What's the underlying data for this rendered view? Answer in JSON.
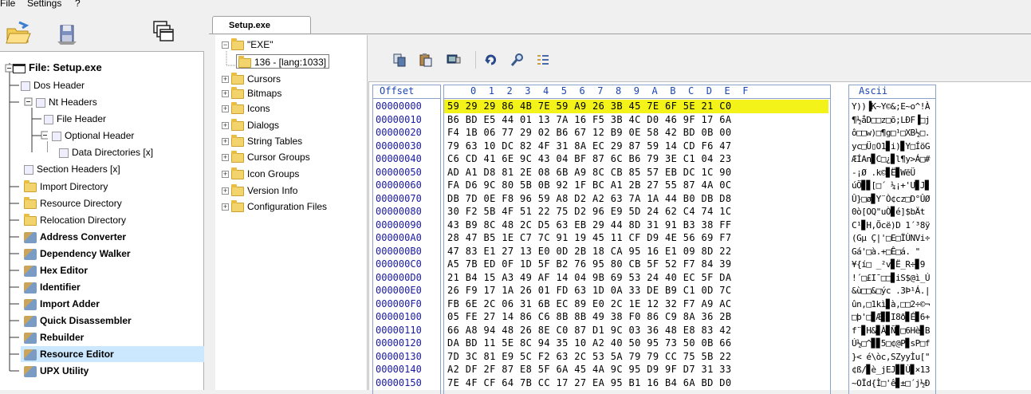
{
  "menu": {
    "file": "File",
    "settings": "Settings",
    "help": "?"
  },
  "left_tree": {
    "items": [
      {
        "label": "File: Setup.exe",
        "bold": true,
        "icon": "window-icon"
      },
      {
        "label": "Dos Header",
        "icon": "list-icon"
      },
      {
        "label": "Nt Headers",
        "icon": "list-icon"
      },
      {
        "label": "File Header",
        "icon": "list-icon"
      },
      {
        "label": "Optional Header",
        "icon": "list-icon"
      },
      {
        "label": "Data Directories [x]",
        "icon": "list-icon"
      },
      {
        "label": "Section Headers [x]",
        "icon": "list-icon"
      },
      {
        "label": "Import Directory",
        "icon": "folder-icon"
      },
      {
        "label": "Resource Directory",
        "icon": "folder-icon"
      },
      {
        "label": "Relocation Directory",
        "icon": "folder-icon"
      },
      {
        "label": "Address Converter",
        "bold": true,
        "icon": "tool-icon"
      },
      {
        "label": "Dependency Walker",
        "bold": true,
        "icon": "tool-icon"
      },
      {
        "label": "Hex Editor",
        "bold": true,
        "icon": "tool-icon"
      },
      {
        "label": "Identifier",
        "bold": true,
        "icon": "tool-icon"
      },
      {
        "label": "Import Adder",
        "bold": true,
        "icon": "tool-icon"
      },
      {
        "label": "Quick Disassembler",
        "bold": true,
        "icon": "tool-icon"
      },
      {
        "label": "Rebuilder",
        "bold": true,
        "icon": "tool-icon"
      },
      {
        "label": "Resource Editor",
        "bold": true,
        "icon": "tool-icon",
        "selected": true
      },
      {
        "label": "UPX Utility",
        "bold": true,
        "icon": "tool-icon"
      }
    ]
  },
  "tab": {
    "label": "Setup.exe"
  },
  "resource_tree": {
    "items": [
      {
        "label": "\"EXE\""
      },
      {
        "label": "136 - [lang:1033]"
      },
      {
        "label": "Cursors"
      },
      {
        "label": "Bitmaps"
      },
      {
        "label": "Icons"
      },
      {
        "label": "Dialogs"
      },
      {
        "label": "String Tables"
      },
      {
        "label": "Cursor Groups"
      },
      {
        "label": "Icon Groups"
      },
      {
        "label": "Version Info"
      },
      {
        "label": "Configuration Files"
      }
    ]
  },
  "hex": {
    "offset_header": "Offset",
    "columns_header": "0  1  2  3  4  5  6  7  8  9  A  B  C  D  E  F",
    "ascii_header": "Ascii",
    "offsets": [
      "00000000",
      "00000010",
      "00000020",
      "00000030",
      "00000040",
      "00000050",
      "00000060",
      "00000070",
      "00000080",
      "00000090",
      "000000A0",
      "000000B0",
      "000000C0",
      "000000D0",
      "000000E0",
      "000000F0",
      "00000100",
      "00000110",
      "00000120",
      "00000130",
      "00000140",
      "00000150"
    ],
    "bytes": [
      "59 29 29 86 4B 7E 59 A9 26 3B 45 7E 6F 5E 21 C0",
      "B6 BD E5 44 01 13 7A 16 F5 3B 4C D0 46 9F 17 6A",
      "F4 1B 06 77 29 02 B6 67 12 B9 0E 58 42 BD 0B 00",
      "79 63 10 DC 82 4F 31 8A EC 29 87 59 14 CD F6 47",
      "C6 CD 41 6E 9C 43 04 BF 87 6C B6 79 3E C1 04 23",
      "AD A1 D8 81 2E 08 6B A9 8C CB 85 57 EB DC 1C 90",
      "FA D6 9C 80 5B 0B 92 1F BC A1 2B 27 55 87 4A 0C",
      "DB 7D 0E F8 96 59 A8 D2 A2 63 7A 1A 44 B0 DB D8",
      "30 F2 5B 4F 51 22 75 D2 96 E9 5D 24 62 C4 74 1C",
      "43 B9 8C 48 2C D5 63 EB 29 44 8D 31 91 B3 38 FF",
      "28 47 B5 1E C7 7C 91 19 45 11 CF D9 4E 56 69 F7",
      "47 83 E1 27 13 E0 0D 2B 18 CA 95 16 E1 09 8D 22",
      "A5 7B ED 0F 1D 5F B2 76 95 80 CB 5F 52 F7 84 39",
      "21 B4 15 A3 49 AF 14 04 9B 69 53 24 40 EC 5F DA",
      "26 F9 17 1A 26 01 FD 63 1D 0A 33 DE B9 C1 0D 7C",
      "FB 6E 2C 06 31 6B EC 89 E0 2C 1E 12 32 F7 A9 AC",
      "05 FE 27 14 86 C6 8B 8B 49 38 F0 86 C9 8A 36 2B",
      "66 A8 94 48 26 8E C0 87 D1 9C 03 36 48 E8 83 42",
      "DA BD 11 5E 8C 94 35 10 A2 40 50 95 73 50 0B 66",
      "7D 3C 81 E9 5C F2 63 2C 53 5A 79 79 CC 75 5B 22",
      "A2 DF 2F 87 E8 5F 6A 45 4A 9C 95 D9 9F D7 31 33",
      "7E 4F CF 64 7B CC 17 27 EA 95 B1 16 B4 6A BD D0"
    ],
    "ascii": [
      "Y))▐K~Y©&;E~o^!À",
      "¶½åD□□z□õ;LÐF▐□j",
      "ô□□w)□¶g□¹□XB½□.",
      "yc□Ü▯O1▊i)▊Y□ÍöG",
      "ÆÍAn▊C□¿▊l¶y>Á□#",
      "-¡Ø .k©▊Ë▊WëÜ",
      "úÖ▊▊[□´ ¼¡+'U▊J▊",
      "Û}□ø▊Y¨Ò¢cz□D°ÛØ",
      "0ò[OQ\"uÒ▊é]$bÄt",
      "C¹▊H,Õcë)D 1´³8ÿ",
      "(Gµ Ç|'□E□ÏÙNVi÷",
      "Gá'□à.+□Ê□á. \"",
      "¥{í□ _²v▊Ë_R÷▊9",
      "!´□£I¯□□▊iS$@ì_Ú",
      "&ù□□&□ýc .3Þ¹Á.|",
      "ûn,□1kì▊à,□□2÷©¬",
      "□þ'□▊Æ▊▊I8ð▊É▊6+",
      "f¨▊H&▊À▊Ñ▊□6Hè▊B",
      "Ú½□^▊▊5□¢@P▊sP□f",
      "}< é\\òc,SZyyÌu[\"",
      "¢ß/▊è_jEJ▊▊Ù▊×13",
      "~OÏd{Ì□'ê▊±□´j½Ð"
    ]
  }
}
